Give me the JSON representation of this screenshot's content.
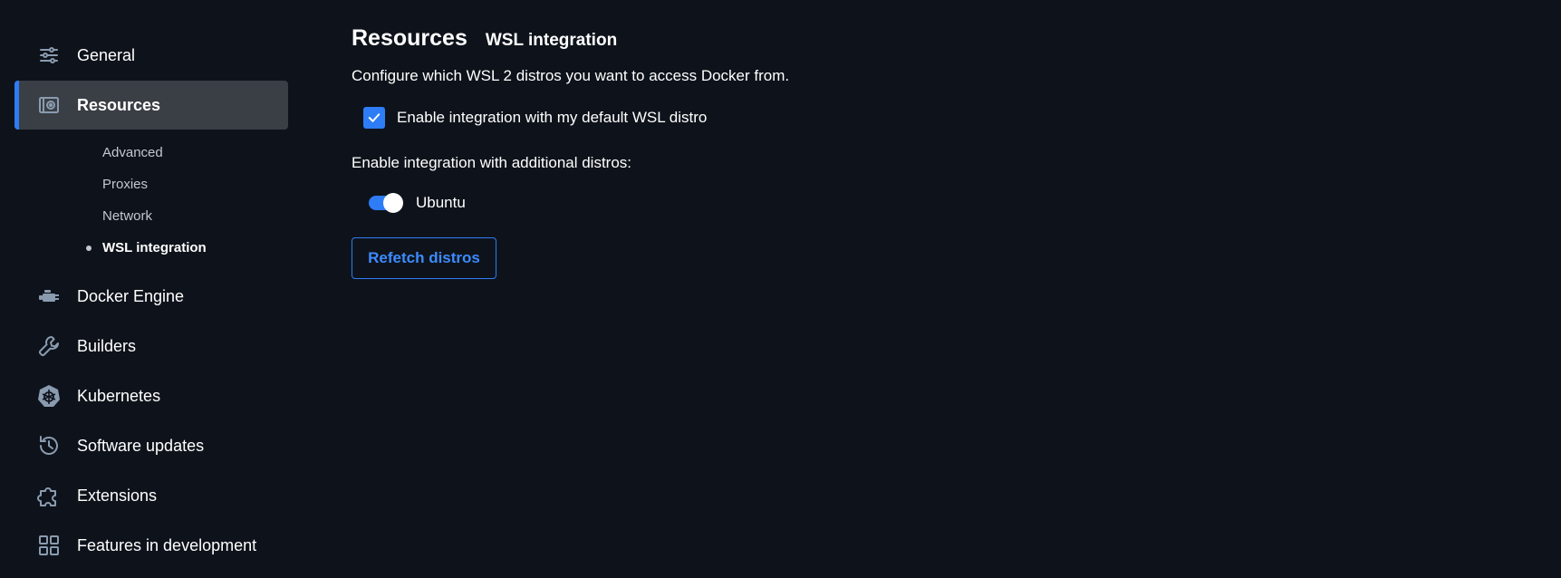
{
  "sidebar": {
    "items": [
      {
        "label": "General",
        "icon": "sliders-icon"
      },
      {
        "label": "Resources",
        "icon": "resources-icon",
        "active": true
      },
      {
        "label": "Docker Engine",
        "icon": "engine-icon"
      },
      {
        "label": "Builders",
        "icon": "wrench-icon"
      },
      {
        "label": "Kubernetes",
        "icon": "kubernetes-icon"
      },
      {
        "label": "Software updates",
        "icon": "clock-update-icon"
      },
      {
        "label": "Extensions",
        "icon": "puzzle-icon"
      },
      {
        "label": "Features in development",
        "icon": "grid-icon"
      }
    ],
    "resources_subitems": [
      {
        "label": "Advanced"
      },
      {
        "label": "Proxies"
      },
      {
        "label": "Network"
      },
      {
        "label": "WSL integration",
        "active": true
      }
    ]
  },
  "main": {
    "title": "Resources",
    "subtitle": "WSL integration",
    "description": "Configure which WSL 2 distros you want to access Docker from.",
    "default_distro_checkbox": {
      "label": "Enable integration with my default WSL distro",
      "checked": true
    },
    "additional_label": "Enable integration with additional distros:",
    "distros": [
      {
        "name": "Ubuntu",
        "enabled": true
      }
    ],
    "refetch_button": "Refetch distros"
  },
  "colors": {
    "background": "#0e131b",
    "accent": "#2e7cf6",
    "active_item_bg": "#3a3f45",
    "icon": "#8a9bb0"
  }
}
